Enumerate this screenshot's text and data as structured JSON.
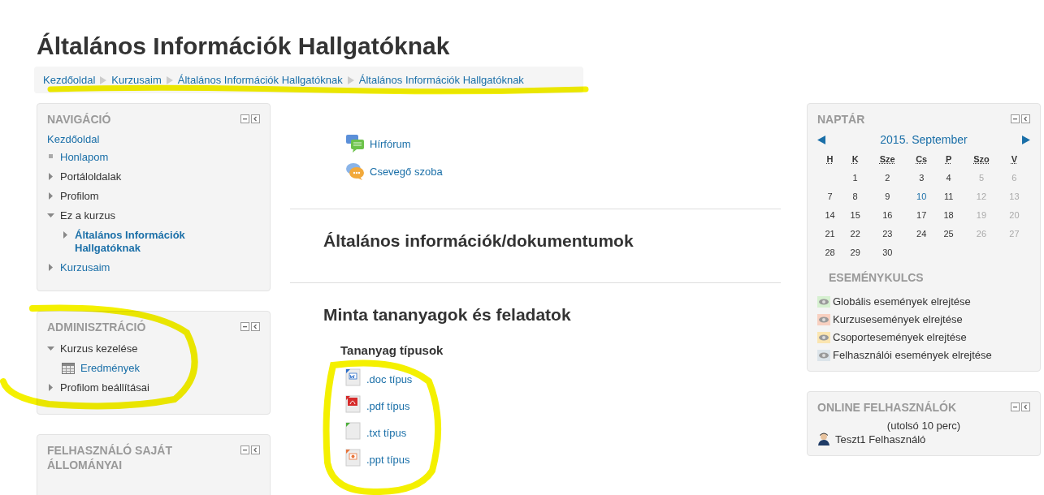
{
  "page_title": "Általános Információk Hallgatóknak",
  "breadcrumb": [
    "Kezdőoldal",
    "Kurzusaim",
    "Általános Információk Hallgatóknak",
    "Általános Információk Hallgatóknak"
  ],
  "navigation": {
    "title": "NAVIGÁCIÓ",
    "home": "Kezdőoldal",
    "items": [
      {
        "label": "Honlapom",
        "kind": "leaf",
        "link": true,
        "current": false
      },
      {
        "label": "Portáloldalak",
        "kind": "branch",
        "link": false,
        "current": false,
        "expanded": false
      },
      {
        "label": "Profilom",
        "kind": "branch",
        "link": false,
        "current": false,
        "expanded": false
      },
      {
        "label": "Ez a kurzus",
        "kind": "branch",
        "link": false,
        "current": false,
        "expanded": true,
        "children": [
          {
            "label": "Általános Információk Hallgatóknak",
            "kind": "branch",
            "link": true,
            "current": true,
            "expanded": false
          }
        ]
      },
      {
        "label": "Kurzusaim",
        "kind": "branch",
        "link": true,
        "current": false,
        "expanded": false
      }
    ]
  },
  "administration": {
    "title": "ADMINISZTRÁCIÓ",
    "items": [
      {
        "label": "Kurzus kezelése",
        "kind": "branch",
        "link": false,
        "current": false,
        "expanded": true,
        "children": [
          {
            "label": "Eredmények",
            "kind": "grades",
            "link": true,
            "current": false
          }
        ]
      },
      {
        "label": "Profilom beállításai",
        "kind": "branch",
        "link": false,
        "current": false,
        "expanded": false
      }
    ]
  },
  "private_files": {
    "title": "FELHASZNÁLÓ SAJÁT ÁLLOMÁNYAI"
  },
  "activities": [
    {
      "label": "Hírfórum",
      "kind": "forum"
    },
    {
      "label": "Csevegő szoba",
      "kind": "chat"
    }
  ],
  "sections": [
    {
      "heading": "Általános információk/dokumentumok"
    },
    {
      "heading": "Minta tananyagok és feladatok",
      "subheading": "Tananyag típusok",
      "files": [
        {
          "label": ".doc típus",
          "kind": "doc"
        },
        {
          "label": ".pdf típus",
          "kind": "pdf"
        },
        {
          "label": ".txt típus",
          "kind": "txt"
        },
        {
          "label": ".ppt típus",
          "kind": "ppt"
        }
      ]
    }
  ],
  "calendar": {
    "title": "NAPTÁR",
    "month": "2015. September",
    "weekdays": [
      "H",
      "K",
      "Sze",
      "Cs",
      "P",
      "Szo",
      "V"
    ],
    "weeks": [
      [
        {
          "day": "1",
          "weekend": false,
          "today": false
        },
        {
          "day": "2",
          "weekend": false,
          "today": false
        },
        {
          "day": "3",
          "weekend": false,
          "today": false
        },
        {
          "day": "4",
          "weekend": false,
          "today": false
        },
        {
          "day": "5",
          "weekend": true,
          "today": false
        },
        {
          "day": "6",
          "weekend": true,
          "today": false
        }
      ],
      [
        {
          "day": "7",
          "weekend": false,
          "today": false
        },
        {
          "day": "8",
          "weekend": false,
          "today": false
        },
        {
          "day": "9",
          "weekend": false,
          "today": false
        },
        {
          "day": "10",
          "weekend": false,
          "today": true
        },
        {
          "day": "11",
          "weekend": false,
          "today": false
        },
        {
          "day": "12",
          "weekend": true,
          "today": false
        },
        {
          "day": "13",
          "weekend": true,
          "today": false
        }
      ],
      [
        {
          "day": "14",
          "weekend": false,
          "today": false
        },
        {
          "day": "15",
          "weekend": false,
          "today": false
        },
        {
          "day": "16",
          "weekend": false,
          "today": false
        },
        {
          "day": "17",
          "weekend": false,
          "today": false
        },
        {
          "day": "18",
          "weekend": false,
          "today": false
        },
        {
          "day": "19",
          "weekend": true,
          "today": false
        },
        {
          "day": "20",
          "weekend": true,
          "today": false
        }
      ],
      [
        {
          "day": "21",
          "weekend": false,
          "today": false
        },
        {
          "day": "22",
          "weekend": false,
          "today": false
        },
        {
          "day": "23",
          "weekend": false,
          "today": false
        },
        {
          "day": "24",
          "weekend": false,
          "today": false
        },
        {
          "day": "25",
          "weekend": false,
          "today": false
        },
        {
          "day": "26",
          "weekend": true,
          "today": false
        },
        {
          "day": "27",
          "weekend": true,
          "today": false
        }
      ],
      [
        {
          "day": "28",
          "weekend": false,
          "today": false
        },
        {
          "day": "29",
          "weekend": false,
          "today": false
        },
        {
          "day": "30",
          "weekend": false,
          "today": false
        }
      ]
    ],
    "key_title": "ESEMÉNYKULCS",
    "key": [
      {
        "label": "Globális események elrejtése",
        "color": "#d6f0d0"
      },
      {
        "label": "Kurzusesemények elrejtése",
        "color": "#f8d0c0"
      },
      {
        "label": "Csoportesemények elrejtése",
        "color": "#fbe5b0"
      },
      {
        "label": "Felhasználói események elrejtése",
        "color": "#dce4ea"
      }
    ]
  },
  "online_users": {
    "title": "ONLINE FELHASZNÁLÓK",
    "period": "(utolsó 10 perc)",
    "users": [
      "Teszt1 Felhasználó"
    ]
  }
}
